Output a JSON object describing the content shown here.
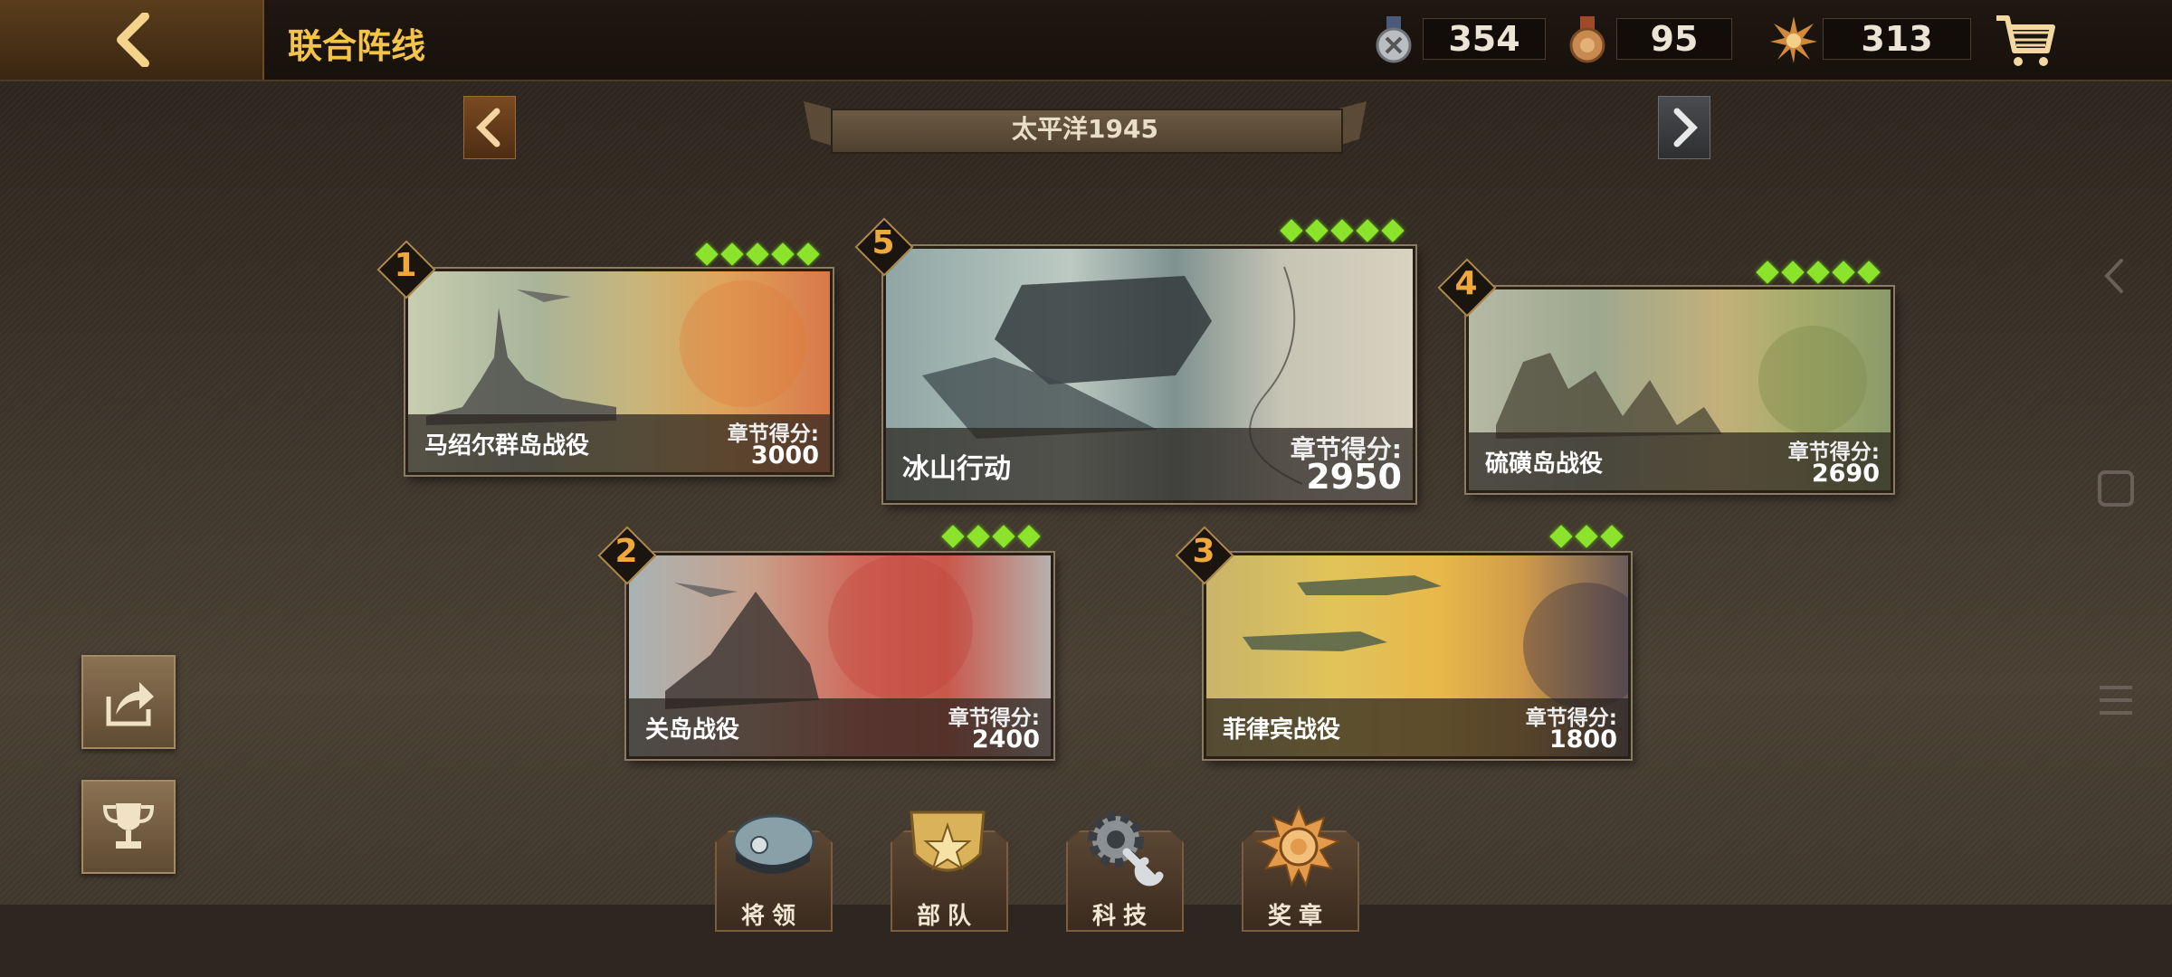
{
  "header": {
    "title": "联合阵线",
    "resources": [
      {
        "name": "silver-medal",
        "value": "354"
      },
      {
        "name": "bronze-medal",
        "value": "95"
      },
      {
        "name": "sun-emblem",
        "value": "313"
      }
    ]
  },
  "campaign": {
    "title": "太平洋1945"
  },
  "score_label": "章节得分:",
  "chapters": [
    {
      "number": "1",
      "name": "马绍尔群岛战役",
      "score": "3000",
      "stars": 5
    },
    {
      "number": "5",
      "name": "冰山行动",
      "score": "2950",
      "stars": 5
    },
    {
      "number": "4",
      "name": "硫磺岛战役",
      "score": "2690",
      "stars": 5
    },
    {
      "number": "2",
      "name": "关岛战役",
      "score": "2400",
      "stars": 4
    },
    {
      "number": "3",
      "name": "菲律宾战役",
      "score": "1800",
      "stars": 3
    }
  ],
  "menu": [
    {
      "label": "将领",
      "icon": "officer-cap-icon"
    },
    {
      "label": "部队",
      "icon": "army-shield-icon"
    },
    {
      "label": "科技",
      "icon": "gear-wrench-icon"
    },
    {
      "label": "奖章",
      "icon": "medal-icon"
    }
  ],
  "colors": {
    "accent": "#f3c34a",
    "star": "#8be32b",
    "badge_number": "#f0a83a"
  }
}
